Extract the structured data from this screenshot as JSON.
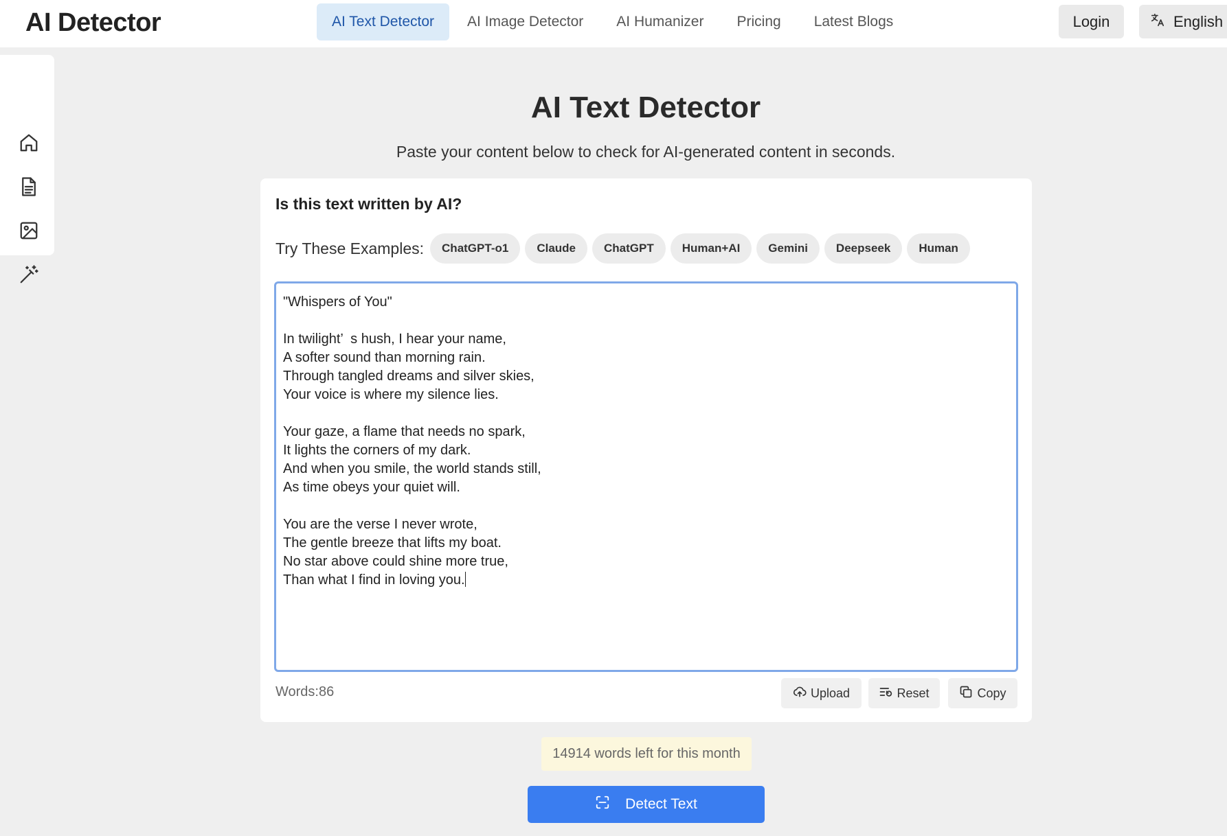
{
  "header": {
    "logo": "AI Detector",
    "nav": [
      {
        "label": "AI Text Detector",
        "active": true
      },
      {
        "label": "AI Image Detector",
        "active": false
      },
      {
        "label": "AI Humanizer",
        "active": false
      },
      {
        "label": "Pricing",
        "active": false
      },
      {
        "label": "Latest Blogs",
        "active": false
      }
    ],
    "login_label": "Login",
    "language_label": "English"
  },
  "sidebar": {
    "icons": [
      "home-icon",
      "document-icon",
      "image-icon",
      "magic-wand-icon"
    ]
  },
  "main": {
    "title": "AI Text Detector",
    "subtitle": "Paste your content below to check for AI-generated content in seconds.",
    "question": "Is this text written by AI?",
    "examples_label": "Try These Examples:",
    "examples": [
      "ChatGPT-o1",
      "Claude",
      "ChatGPT",
      "Human+AI",
      "Gemini",
      "Deepseek",
      "Human"
    ],
    "editor_text": "\"Whispers of You\"\n\nIn twilight’  s hush, I hear your name,\nA softer sound than morning rain.\nThrough tangled dreams and silver skies,\nYour voice is where my silence lies.\n\nYour gaze, a flame that needs no spark,\nIt lights the corners of my dark.\nAnd when you smile, the world stands still,\nAs time obeys your quiet will.\n\nYou are the verse I never wrote,\nThe gentle breeze that lifts my boat.\nNo star above could shine more true,\nThan what I find in loving you.",
    "word_count": "Words:86",
    "upload_label": "Upload",
    "reset_label": "Reset",
    "copy_label": "Copy",
    "quota_text": "14914 words left for this month",
    "detect_label": "Detect Text"
  },
  "colors": {
    "accent": "#3a7df0",
    "nav_active_bg": "#dcebf8",
    "nav_active_text": "#1f56a8",
    "quota_bg": "#fcf7dd"
  }
}
